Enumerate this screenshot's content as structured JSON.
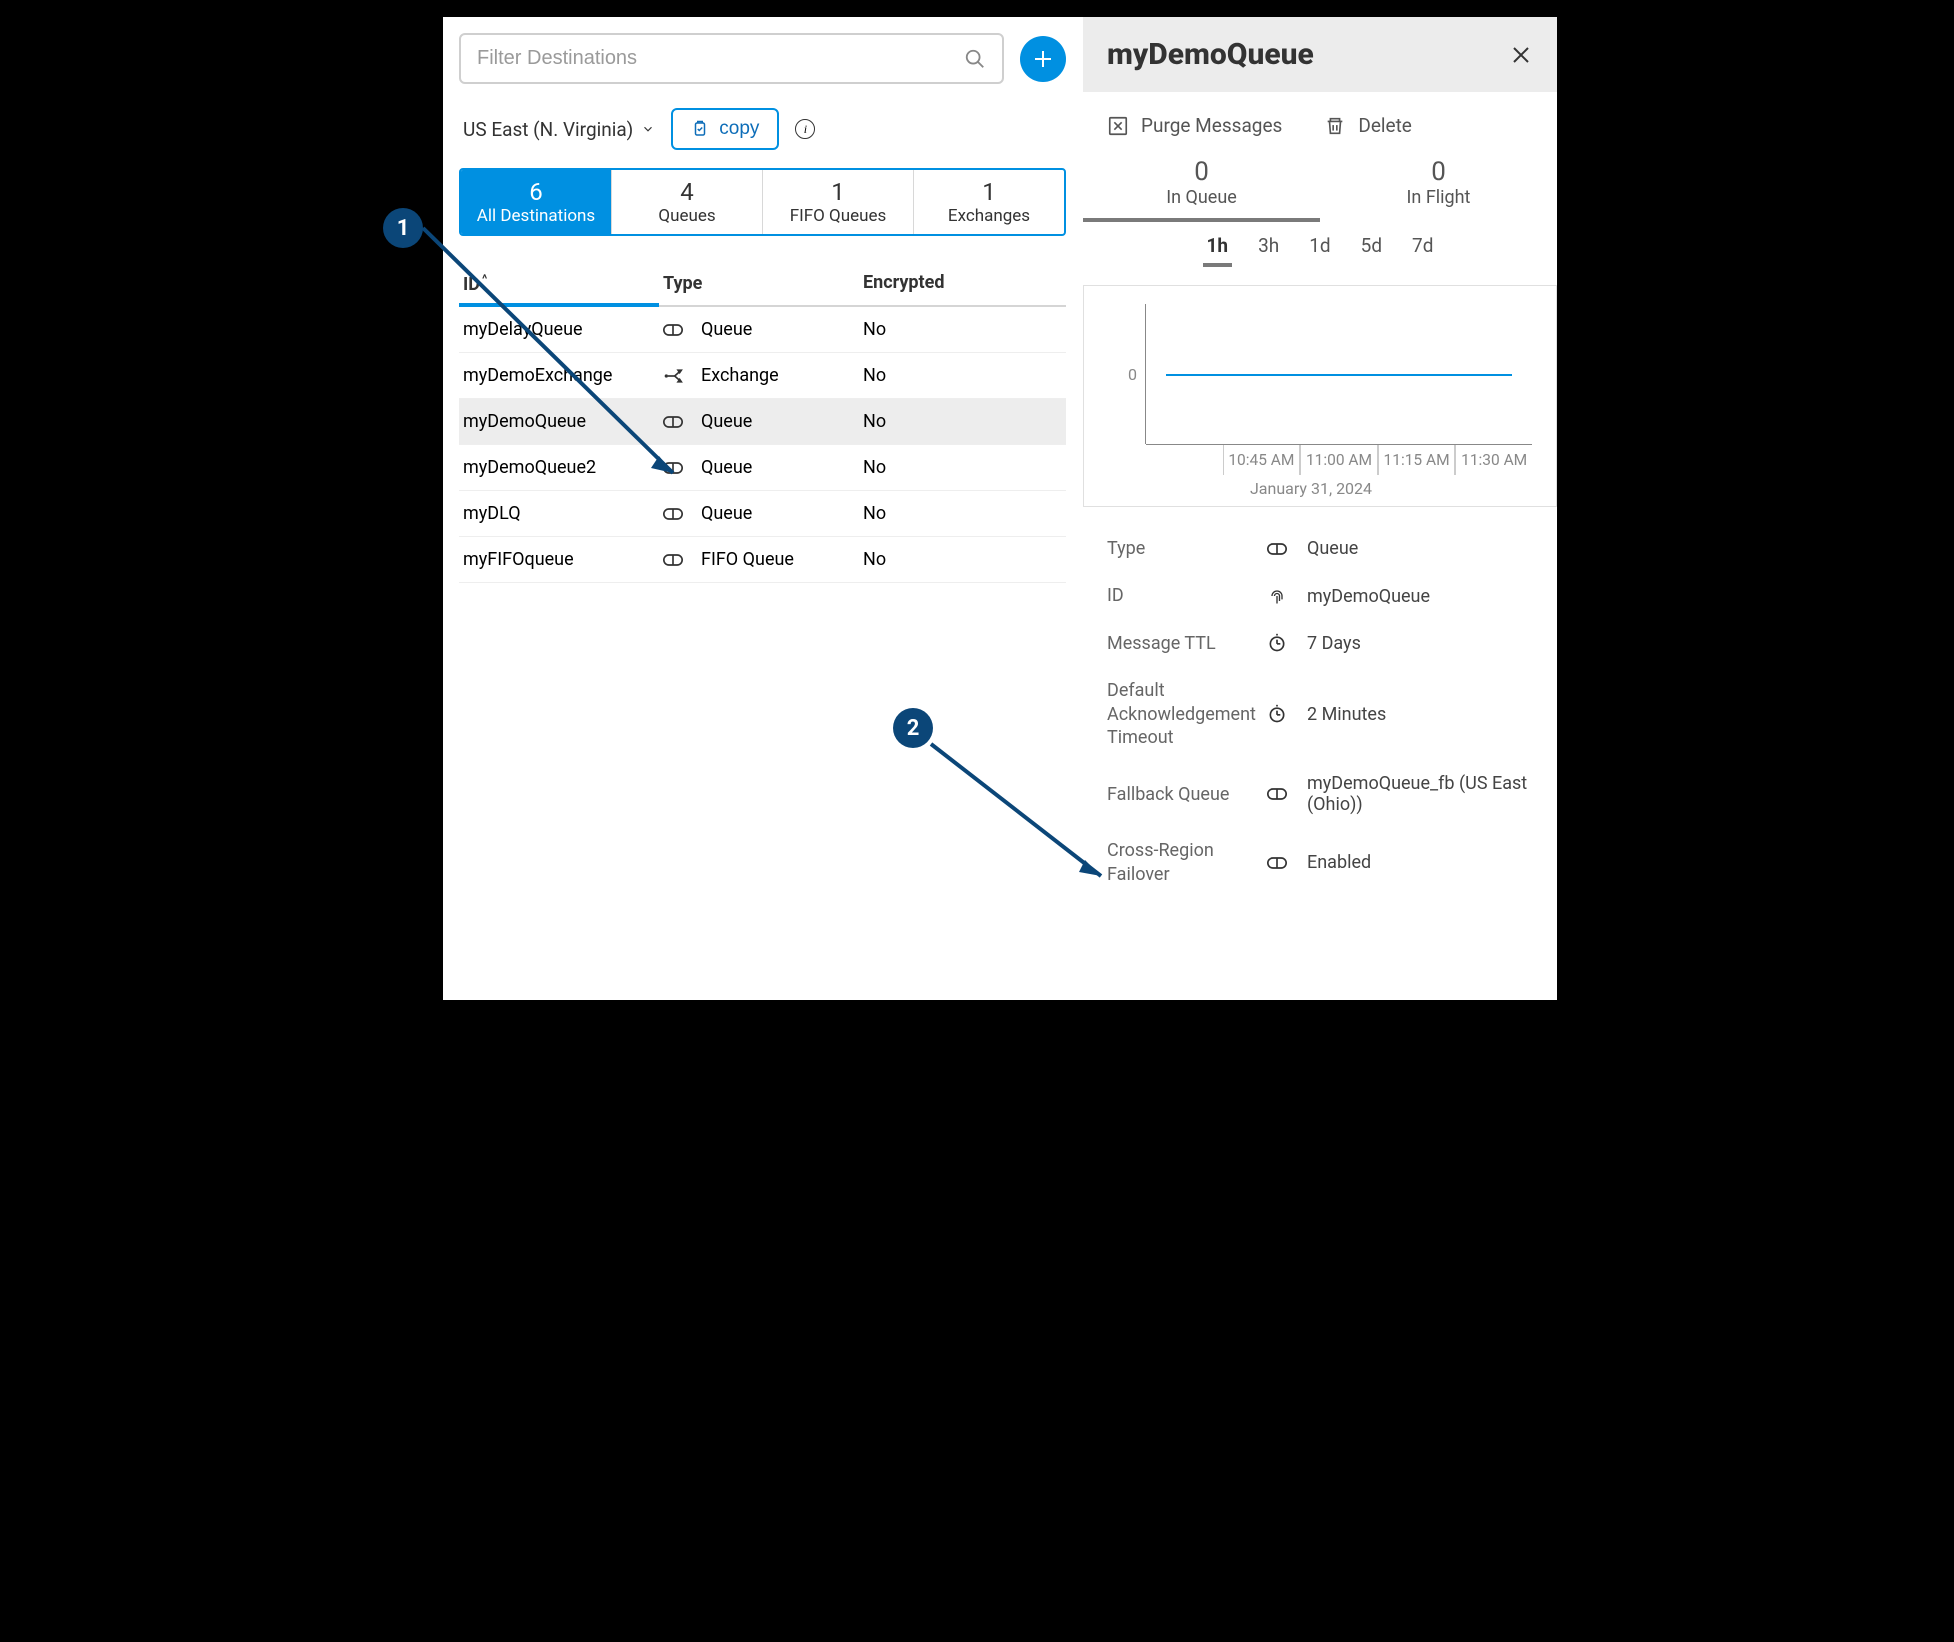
{
  "search": {
    "placeholder": "Filter Destinations"
  },
  "region": {
    "label": "US East (N. Virginia)"
  },
  "copy_label": "copy",
  "tabs": [
    {
      "count": "6",
      "label": "All Destinations"
    },
    {
      "count": "4",
      "label": "Queues"
    },
    {
      "count": "1",
      "label": "FIFO Queues"
    },
    {
      "count": "1",
      "label": "Exchanges"
    }
  ],
  "table": {
    "headers": {
      "id": "ID",
      "type": "Type",
      "encrypted": "Encrypted"
    },
    "sort_indicator": "^",
    "rows": [
      {
        "id": "myDelayQueue",
        "type": "Queue",
        "icon": "queue",
        "encrypted": "No"
      },
      {
        "id": "myDemoExchange",
        "type": "Exchange",
        "icon": "exchange",
        "encrypted": "No"
      },
      {
        "id": "myDemoQueue",
        "type": "Queue",
        "icon": "queue",
        "encrypted": "No",
        "selected": true
      },
      {
        "id": "myDemoQueue2",
        "type": "Queue",
        "icon": "queue",
        "encrypted": "No"
      },
      {
        "id": "myDLQ",
        "type": "Queue",
        "icon": "queue",
        "encrypted": "No"
      },
      {
        "id": "myFIFOqueue",
        "type": "FIFO Queue",
        "icon": "queue",
        "encrypted": "No"
      }
    ]
  },
  "details": {
    "title": "myDemoQueue",
    "actions": {
      "purge": "Purge Messages",
      "delete": "Delete"
    },
    "stats": [
      {
        "n": "0",
        "l": "In Queue",
        "selected": true
      },
      {
        "n": "0",
        "l": "In Flight"
      }
    ],
    "time_tabs": [
      "1h",
      "3h",
      "1d",
      "5d",
      "7d"
    ],
    "time_selected": "1h",
    "chart": {
      "y_tick": "0",
      "x_ticks": [
        "",
        "10:45 AM",
        "11:00 AM",
        "11:15 AM",
        "11:30 AM"
      ],
      "date": "January 31, 2024"
    },
    "props": [
      {
        "k": "Type",
        "icon": "queue",
        "v": "Queue"
      },
      {
        "k": "ID",
        "icon": "fingerprint",
        "v": "myDemoQueue"
      },
      {
        "k": "Message TTL",
        "icon": "clock",
        "v": "7 Days"
      },
      {
        "k": "Default Acknowledgement Timeout",
        "icon": "clock",
        "v": "2 Minutes"
      },
      {
        "k": "Fallback Queue",
        "icon": "queue",
        "v": "myDemoQueue_fb (US East (Ohio))"
      },
      {
        "k": "Cross-Region Failover",
        "icon": "queue",
        "v": "Enabled"
      }
    ]
  },
  "annotations": {
    "one": "1",
    "two": "2"
  },
  "chart_data": {
    "type": "line",
    "title": "In Queue",
    "x": [
      "10:45 AM",
      "11:00 AM",
      "11:15 AM",
      "11:30 AM"
    ],
    "series": [
      {
        "name": "In Queue",
        "values": [
          0,
          0,
          0,
          0
        ]
      }
    ],
    "ylim": [
      0,
      1
    ],
    "ylabel": "",
    "xlabel": "January 31, 2024"
  }
}
